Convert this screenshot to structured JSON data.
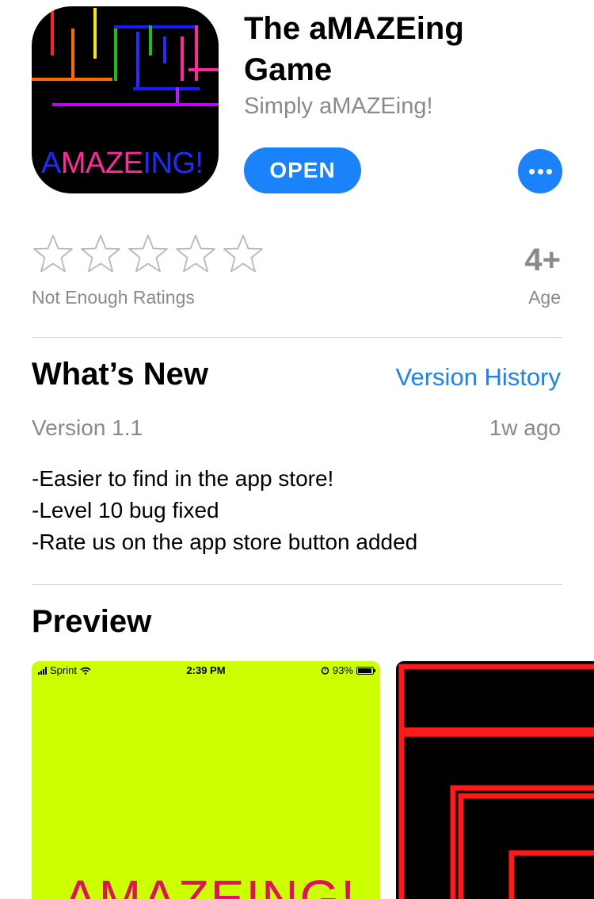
{
  "app": {
    "title": "The aMAZEing Game",
    "subtitle": "Simply aMAZEing!",
    "icon_text": {
      "part1": "A",
      "part2": "MAZE",
      "part3": "ING!"
    },
    "open_label": "OPEN",
    "more_icon": "ellipsis-icon"
  },
  "ratings": {
    "stars_filled": 0,
    "stars_total": 5,
    "label": "Not Enough Ratings"
  },
  "age": {
    "value": "4+",
    "label": "Age"
  },
  "whats_new": {
    "title": "What’s New",
    "history_link": "Version History",
    "version": "Version 1.1",
    "date": "1w ago",
    "notes": [
      "-Easier to find in the app store!",
      "-Level 10 bug fixed",
      "-Rate us on the app store button added"
    ]
  },
  "preview": {
    "title": "Preview",
    "screenshot1": {
      "carrier": "Sprint",
      "time": "2:39 PM",
      "battery": "93%",
      "battery_level": 0.93,
      "bg_color": "#ccff00",
      "text": "AMAZEING!"
    },
    "screenshot2": {
      "bg_color": "#000000",
      "accent": "#ff1a1a"
    }
  },
  "colors": {
    "accent": "#1a82fb",
    "secondary_text": "#8a8a8e"
  }
}
